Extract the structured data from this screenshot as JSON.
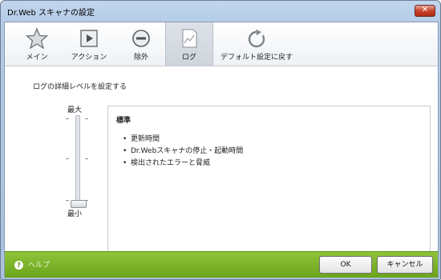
{
  "window": {
    "title": "Dr.Web スキャナの設定",
    "close_label": "✕"
  },
  "toolbar": {
    "items": [
      {
        "label": "メイン",
        "icon": "star-icon"
      },
      {
        "label": "アクション",
        "icon": "play-icon"
      },
      {
        "label": "除外",
        "icon": "minus-circle-icon"
      },
      {
        "label": "ログ",
        "icon": "log-chart-icon",
        "active": true
      },
      {
        "label": "デフォルト設定に戻す",
        "icon": "reset-icon"
      }
    ]
  },
  "log": {
    "section_title": "ログの詳細レベルを設定する",
    "slider": {
      "max_label": "最大",
      "min_label": "最小",
      "level": "最小"
    },
    "description": {
      "title": "標準",
      "items": [
        "更新時間",
        "Dr.Webスキャナの停止・起動時間",
        "検出されたエラーと脅威"
      ]
    }
  },
  "footer": {
    "help_label": "ヘルプ",
    "ok_label": "OK",
    "cancel_label": "キャンセル"
  },
  "colors": {
    "footer_green": "#6aa41b",
    "active_tab": "#cfd5dc"
  }
}
